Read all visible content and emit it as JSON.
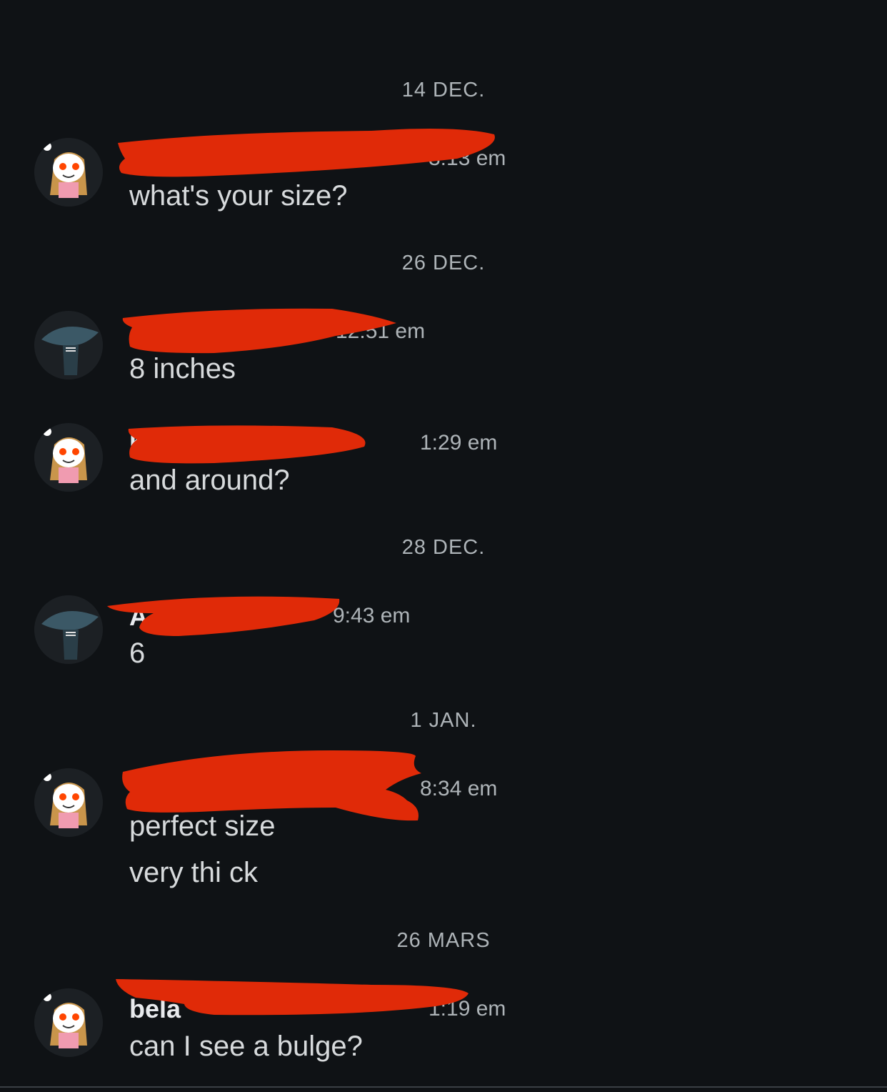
{
  "dates": [
    "14 DEC.",
    "26 DEC.",
    "28 DEC.",
    "1 JAN.",
    "26 MARS"
  ],
  "colors": {
    "background": "#0f1215",
    "redaction": "#e02a08",
    "text_primary": "#d7dadc",
    "text_secondary": "#aeb4b8"
  },
  "messages": [
    {
      "user": "",
      "avatar": "snoo-girl-avatar",
      "time": "3:13 em",
      "lines": [
        "what's your size?"
      ]
    },
    {
      "user": "A",
      "avatar": "alien-avatar",
      "time": "12:51 em",
      "lines": [
        "8 inches"
      ]
    },
    {
      "user": "b",
      "avatar": "snoo-girl-avatar",
      "time": "1:29 em",
      "lines": [
        "and around?"
      ]
    },
    {
      "user": "A",
      "avatar": "alien-avatar",
      "time": "9:43 em",
      "lines": [
        "6"
      ]
    },
    {
      "user": "",
      "avatar": "snoo-girl-avatar",
      "time": "8:34 em",
      "lines": [
        "perfect size",
        "very thi ck"
      ]
    },
    {
      "user": "bela",
      "avatar": "snoo-girl-avatar",
      "time": "1:19 em",
      "lines": [
        "can I see a bulge?"
      ]
    }
  ]
}
